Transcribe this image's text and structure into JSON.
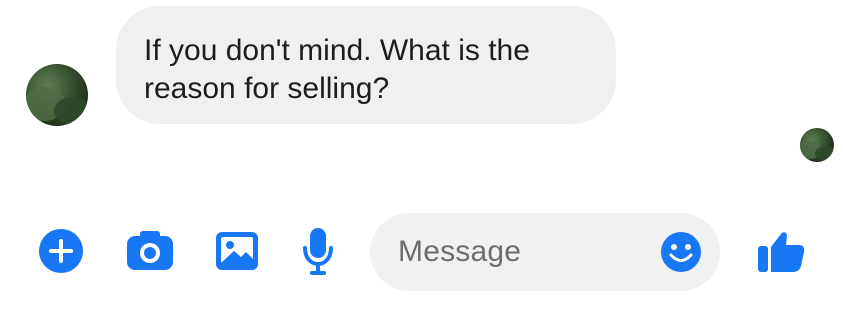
{
  "conversation": {
    "messages": [
      {
        "sender": "other",
        "text": "If you don't mind. What is the\nreason for selling?"
      }
    ]
  },
  "composer": {
    "placeholder": "Message"
  },
  "icons": {
    "add": "plus-icon",
    "camera": "camera-icon",
    "gallery": "image-icon",
    "voice": "microphone-icon",
    "emoji": "emoji-icon",
    "like": "thumbs-up-icon"
  },
  "colors": {
    "accent": "#1877F2",
    "bubble_background": "#F0F0F0",
    "text": "#1D1D1D",
    "placeholder": "#6D6D6D"
  }
}
